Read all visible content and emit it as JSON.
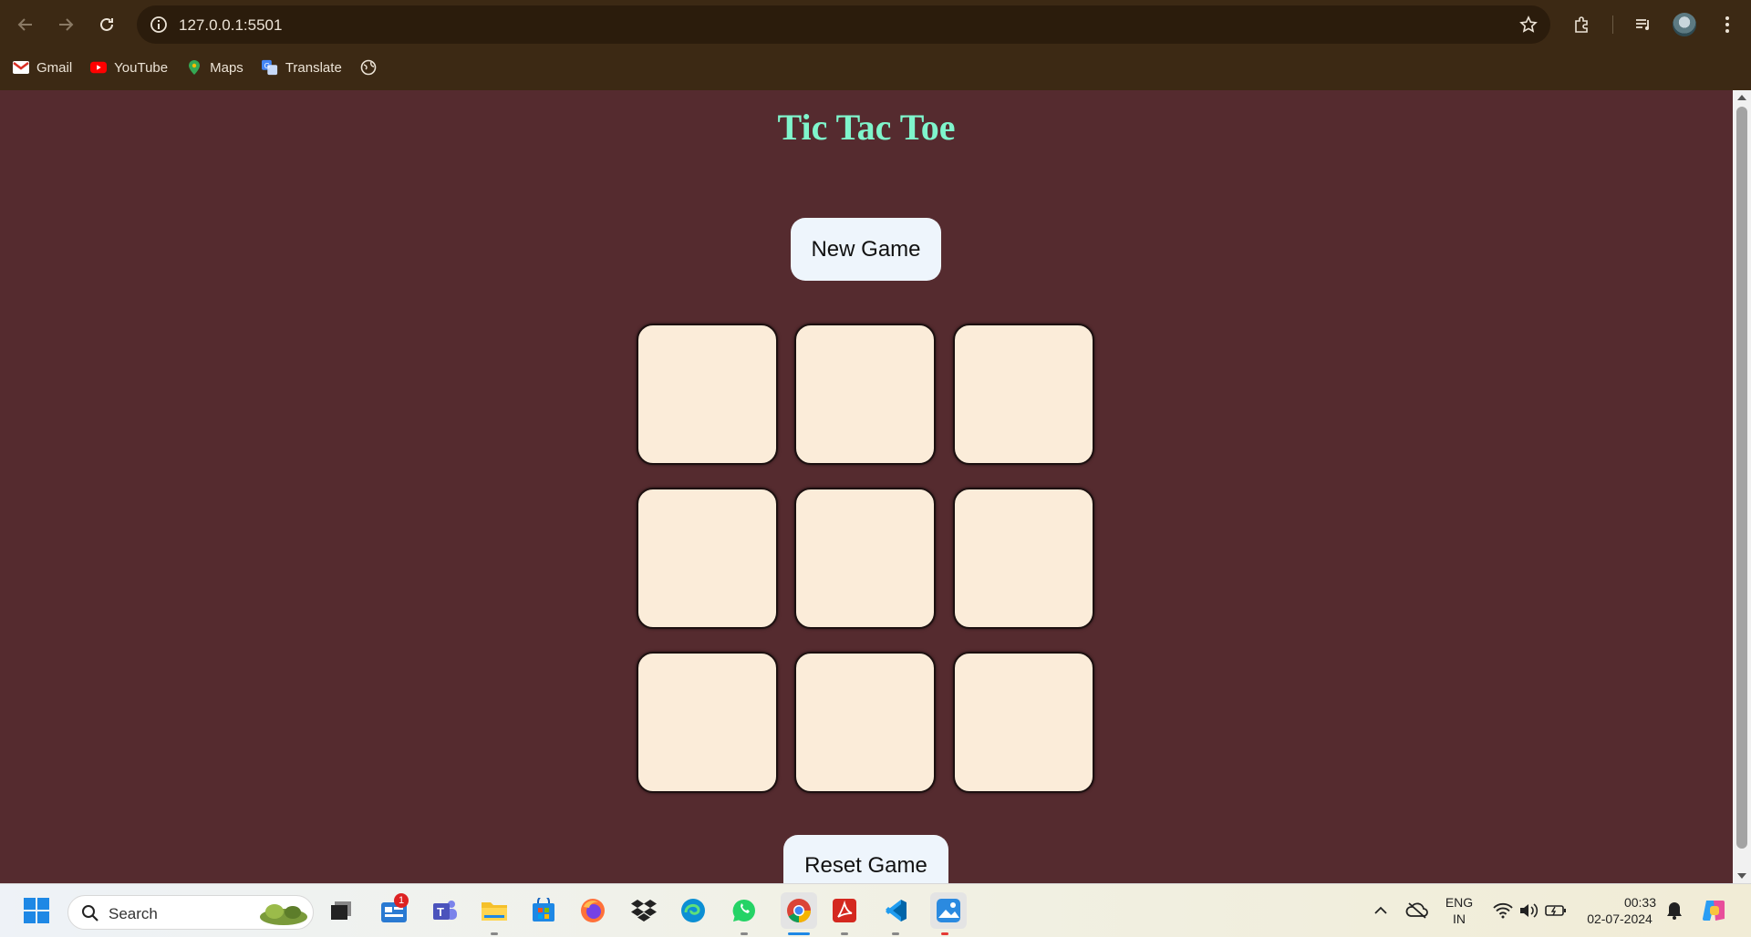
{
  "browser": {
    "url": "127.0.0.1:5501",
    "bookmarks": [
      {
        "label": "Gmail",
        "icon": "gmail-icon"
      },
      {
        "label": "YouTube",
        "icon": "youtube-icon"
      },
      {
        "label": "Maps",
        "icon": "maps-icon"
      },
      {
        "label": "Translate",
        "icon": "translate-icon"
      },
      {
        "label": "",
        "icon": "globe-icon"
      }
    ]
  },
  "page": {
    "title": "Tic Tac Toe",
    "new_game_label": "New Game",
    "reset_game_label": "Reset Game",
    "board": [
      "",
      "",
      "",
      "",
      "",
      "",
      "",
      "",
      ""
    ]
  },
  "colors": {
    "background": "#552b2f",
    "title": "#7ff5cc",
    "cell": "#fbecd9",
    "button": "#eef5fc"
  },
  "taskbar": {
    "search_placeholder": "Search",
    "notification_count": "1",
    "language_top": "ENG",
    "language_bottom": "IN",
    "time": "00:33",
    "date": "02-07-2024"
  }
}
